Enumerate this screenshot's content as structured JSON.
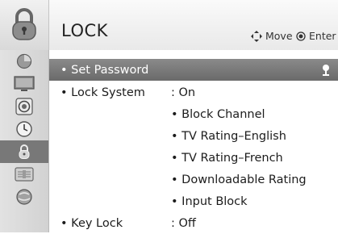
{
  "header": {
    "title": "LOCK",
    "hint_move": "Move",
    "hint_enter": "Enter"
  },
  "sidebar": {
    "items": [
      {
        "icon": "picture-icon"
      },
      {
        "icon": "tv-screen-icon"
      },
      {
        "icon": "speaker-icon"
      },
      {
        "icon": "clock-icon"
      },
      {
        "icon": "lock-icon",
        "active": true
      },
      {
        "icon": "option-icon"
      },
      {
        "icon": "network-icon"
      }
    ]
  },
  "menu": {
    "set_password": "• Set Password",
    "lock_system": "• Lock System",
    "lock_system_value": ": On",
    "sub_items": [
      "• Block Channel",
      "• TV Rating–English",
      "• TV Rating–French",
      "• Downloadable Rating",
      "• Input Block"
    ],
    "key_lock": "• Key Lock",
    "key_lock_value": ": Off"
  },
  "colors": {
    "highlight": "#7a7a7a",
    "active_sidebar": "#787878"
  }
}
